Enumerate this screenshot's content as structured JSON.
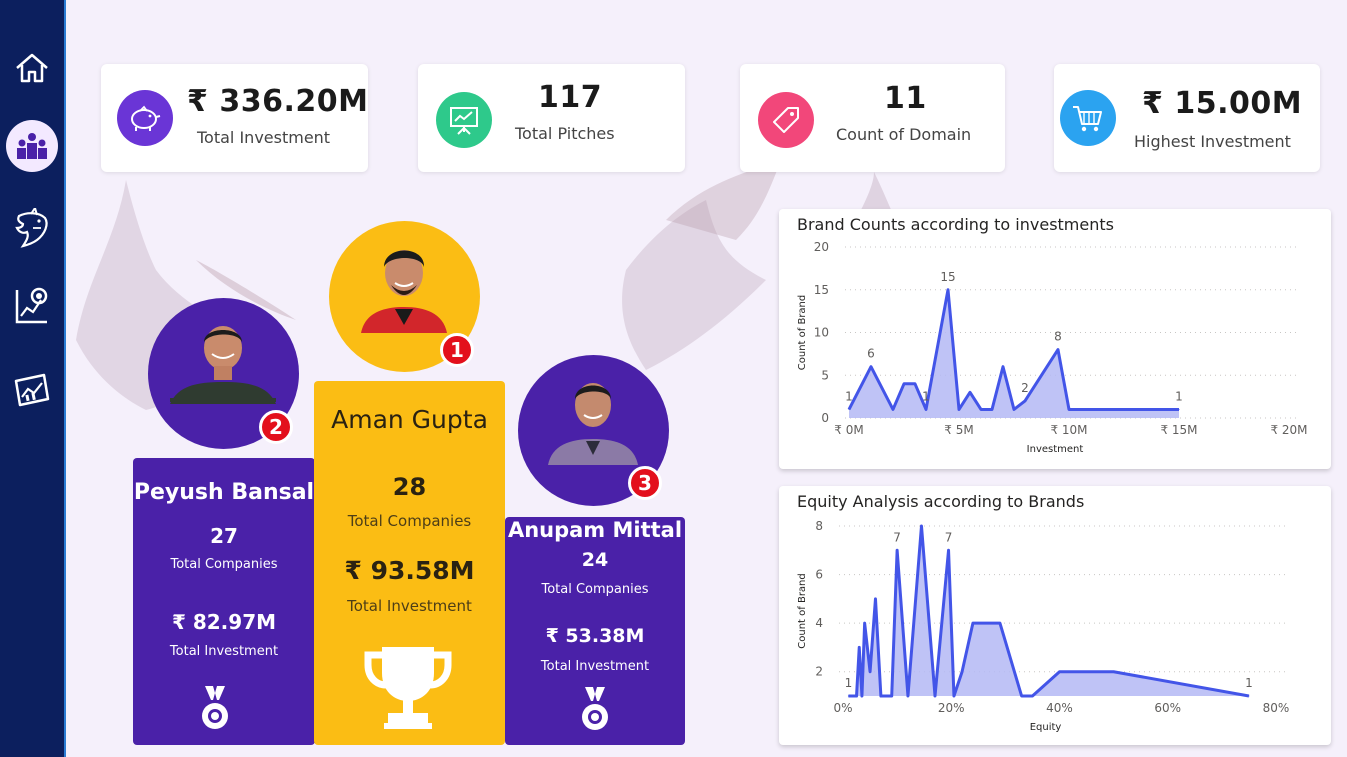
{
  "nav": {
    "items": [
      {
        "name": "home",
        "icon": "home-icon"
      },
      {
        "name": "podium",
        "icon": "podium-icon",
        "active": true
      },
      {
        "name": "shark",
        "icon": "shark-icon"
      },
      {
        "name": "analysis",
        "icon": "chart-analysis-icon"
      },
      {
        "name": "report",
        "icon": "report-chart-icon"
      }
    ]
  },
  "kpis": [
    {
      "value": "₹ 336.20M",
      "label": "Total Investment",
      "icon": "piggy-bank-icon",
      "color": "#6a35d6"
    },
    {
      "value": "117",
      "label": "Total Pitches",
      "icon": "presentation-board-icon",
      "color": "#2ec98b"
    },
    {
      "value": "11",
      "label": "Count of Domain",
      "icon": "price-tag-icon",
      "color": "#f2477a"
    },
    {
      "value": "₹ 15.00M",
      "label": "Highest Investment",
      "icon": "shopping-cart-icon",
      "color": "#2ba3f0"
    }
  ],
  "podium": {
    "first": {
      "rank": "1",
      "name": "Aman Gupta",
      "companies": "28",
      "companies_label": "Total Companies",
      "investment": "₹ 93.58M",
      "investment_label": "Total Investment",
      "color": "#fbbd14"
    },
    "second": {
      "rank": "2",
      "name": "Peyush Bansal",
      "companies": "27",
      "companies_label": "Total Companies",
      "investment": "₹ 82.97M",
      "investment_label": "Total Investment",
      "color": "#4a21a8"
    },
    "third": {
      "rank": "3",
      "name": "Anupam Mittal",
      "companies": "24",
      "companies_label": "Total Companies",
      "investment": "₹ 53.38M",
      "investment_label": "Total Investment",
      "color": "#4a21a8"
    }
  },
  "chart_data": [
    {
      "type": "area",
      "title": "Brand Counts according to investments",
      "xlabel": "Investment",
      "ylabel": "Count of Brand",
      "xlim": [
        0,
        20
      ],
      "ylim": [
        0,
        20
      ],
      "x_ticks": [
        "₹ 0M",
        "₹ 5M",
        "₹ 10M",
        "₹ 15M",
        "₹ 20M"
      ],
      "y_ticks": [
        "0",
        "5",
        "10",
        "15",
        "20"
      ],
      "x_unit": "M rupees",
      "x": [
        0,
        1,
        2,
        2.5,
        3,
        3.5,
        4.5,
        5,
        5.5,
        6,
        6.5,
        7,
        7.5,
        8,
        9.5,
        10,
        15
      ],
      "values": [
        1,
        6,
        1,
        4,
        4,
        1,
        15,
        1,
        3,
        1,
        1,
        6,
        1,
        2,
        8,
        1,
        1
      ],
      "labels": [
        {
          "x": 0,
          "y": 1,
          "text": "1"
        },
        {
          "x": 1,
          "y": 6,
          "text": "6"
        },
        {
          "x": 3.5,
          "y": 1,
          "text": "1"
        },
        {
          "x": 4.5,
          "y": 15,
          "text": "15"
        },
        {
          "x": 8,
          "y": 2,
          "text": "2"
        },
        {
          "x": 9.5,
          "y": 8,
          "text": "8"
        },
        {
          "x": 15,
          "y": 1,
          "text": "1"
        }
      ],
      "color": "#4355e8",
      "fill": "#b4b8f4",
      "grid": "horizontal-dotted"
    },
    {
      "type": "area",
      "title": "Equity Analysis according to Brands",
      "xlabel": "Equity",
      "ylabel": "Count of Brand",
      "xlim": [
        0,
        80
      ],
      "ylim": [
        1,
        8
      ],
      "x_ticks": [
        "0%",
        "20%",
        "40%",
        "60%",
        "80%"
      ],
      "y_ticks": [
        "2",
        "4",
        "6",
        "8"
      ],
      "x_unit": "percent",
      "x": [
        1,
        2.5,
        3,
        3.5,
        4,
        5,
        6,
        7,
        9,
        10,
        12,
        14.5,
        17,
        19.5,
        20.5,
        22,
        24,
        29,
        33,
        35,
        40,
        50,
        75
      ],
      "values": [
        1,
        1,
        3,
        1,
        4,
        2,
        5,
        1,
        1,
        7,
        1,
        8,
        1,
        7,
        1,
        2,
        4,
        4,
        1,
        1,
        2,
        2,
        1
      ],
      "labels": [
        {
          "x": 1,
          "y": 1,
          "text": "1"
        },
        {
          "x": 10,
          "y": 7,
          "text": "7"
        },
        {
          "x": 19.5,
          "y": 7,
          "text": "7"
        },
        {
          "x": 75,
          "y": 1,
          "text": "1"
        }
      ],
      "color": "#4355e8",
      "fill": "#b4b8f4",
      "grid": "horizontal-dotted"
    }
  ]
}
